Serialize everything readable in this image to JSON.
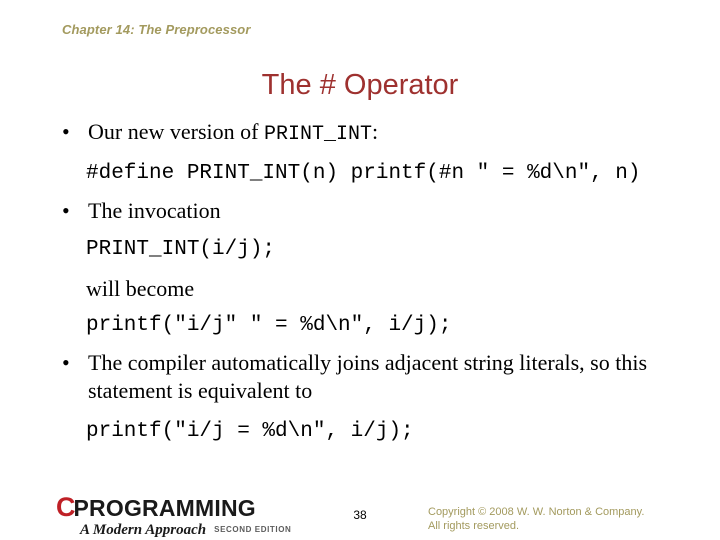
{
  "header": {
    "chapter": "Chapter 14: The Preprocessor",
    "title": "The # Operator",
    "title_color": "#9e312f",
    "chapter_color": "#a39a5e"
  },
  "content": {
    "bullet_marker": "•",
    "bullet1_text": "Our new version of ",
    "bullet1_code": "PRINT_INT",
    "bullet1_tail": ":",
    "code1": "#define PRINT_INT(n) printf(#n \" = %d\\n\", n)",
    "bullet2_text": "The invocation",
    "code2": "PRINT_INT(i/j);",
    "plain1": "will become",
    "code3": "printf(\"i/j\" \" = %d\\n\", i/j);",
    "bullet3_text": "The compiler automatically joins adjacent string literals, so this statement is equivalent to",
    "code4": "printf(\"i/j = %d\\n\", i/j);"
  },
  "footer": {
    "logo_c": "C",
    "logo_word": "PROGRAMMING",
    "logo_subtitle": "A Modern Approach",
    "logo_edition": "SECOND EDITION",
    "logo_c_color": "#bf2026",
    "page_number": "38",
    "copyright_line1": "Copyright © 2008 W. W. Norton & Company.",
    "copyright_line2": "All rights reserved.",
    "copyright_color": "#a39a5e"
  }
}
